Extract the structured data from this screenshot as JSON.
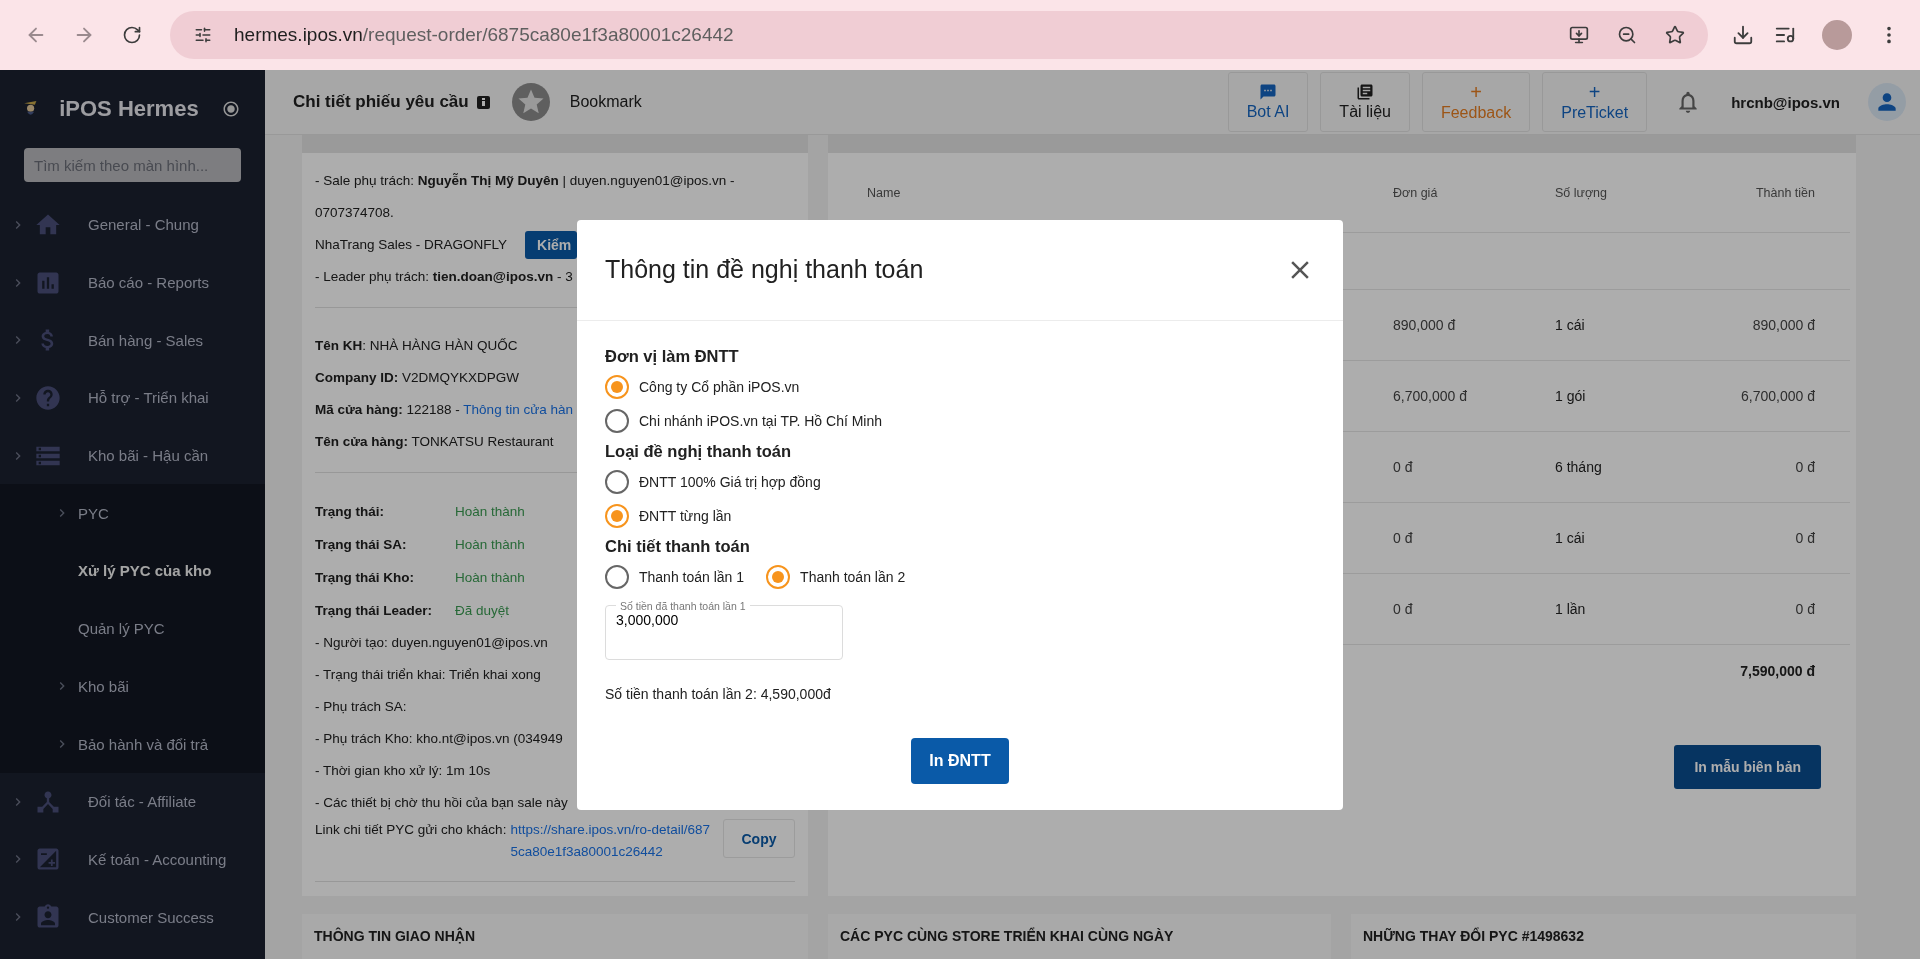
{
  "browser": {
    "url_host": "hermes.ipos.vn",
    "url_path": "/request-order/6875ca80e1f3a80001c26442"
  },
  "sidebar": {
    "brand": "iPOS Hermes",
    "search": {
      "placeholder": "Tìm kiếm theo màn hình..."
    },
    "items": [
      {
        "label": "General - Chung"
      },
      {
        "label": "Báo cáo - Reports"
      },
      {
        "label": "Bán hàng - Sales"
      },
      {
        "label": "Hỗ trợ - Triển khai"
      },
      {
        "label": "Kho bãi - Hậu cần",
        "expanded": true,
        "children": [
          {
            "label": "PYC",
            "kind": "group",
            "selected": false
          },
          {
            "label": "Xử lý PYC của kho",
            "kind": "link",
            "selected": true
          },
          {
            "label": "Quản lý PYC",
            "kind": "link",
            "selected": false
          },
          {
            "label": "Kho bãi",
            "kind": "group",
            "selected": false
          },
          {
            "label": "Bảo hành và đổi trả",
            "kind": "group",
            "selected": false
          }
        ]
      },
      {
        "label": "Đối tác - Affiliate"
      },
      {
        "label": "Kế toán - Accounting"
      },
      {
        "label": "Customer Success"
      }
    ]
  },
  "header": {
    "title": "Chi tiết phiếu yêu cầu",
    "bookmark": "Bookmark",
    "actions": [
      {
        "label": "Bot AI",
        "kind": "icon"
      },
      {
        "label": "Tài liệu",
        "kind": "icon"
      },
      {
        "label": "Feedback",
        "kind": "glyph",
        "glyph": "+"
      },
      {
        "label": "PreTicket",
        "kind": "glyph",
        "glyph": "+"
      }
    ],
    "user": "hrcnb@ipos.vn"
  },
  "request_card": {
    "sale_line": "- Sale phụ trách: **Nguyễn Thị Mỹ Duyên** | duyen.nguyen01@ipos.vn - 0707374708.",
    "team": "NhaTrang Sales - DRAGONFLY",
    "check_button": "Kiểm",
    "leader_line": "- Leader phụ trách: **tien.doan@ipos.vn** - 3",
    "customer": [
      {
        "text": "**Tên KH**: NHÀ HÀNG HÀN QUỐC"
      },
      {
        "text": "**Company ID:** V2DMQYKXDPGW"
      },
      {
        "text": "**Mã cửa hàng:** 122188 - ",
        "link": "Thông tin cửa hàn"
      },
      {
        "text": "**Tên cửa hàng:** TONKATSU Restaurant"
      }
    ],
    "statuses": [
      {
        "label": "Trạng thái:",
        "value": "Hoàn thành"
      },
      {
        "label": "Trạng thái SA:",
        "value": "Hoàn thành"
      },
      {
        "label": "Trạng thái Kho:",
        "value": "Hoàn thành"
      },
      {
        "label": "Trạng thái Leader:",
        "value": "Đã duyệt"
      }
    ],
    "notes": [
      "- Người tạo: duyen.nguyen01@ipos.vn",
      "- Trạng thái triển khai: Triển khai xong",
      "- Phụ trách SA:",
      "- Phụ trách Kho: kho.nt@ipos.vn (034949",
      "- Thời gian kho xử lý: 1m 10s",
      "- Các thiết bị chờ thu hồi của bạn sale này"
    ],
    "share": {
      "label": "Link chi tiết PYC gửi cho khách:",
      "link": "https://share.ipos.vn/ro-detail/6875ca80e1f3a80001c26442",
      "button": "Copy"
    }
  },
  "items_card": {
    "columns": [
      "Name",
      "Đơn giá",
      "Số lượng",
      "Thành tiền"
    ],
    "rows": [
      {
        "price": "890,000 đ",
        "qty": "1 cái",
        "total": "890,000 đ"
      },
      {
        "price": "6,700,000 đ",
        "qty": "1 gói",
        "total": "6,700,000 đ"
      },
      {
        "price": "0 đ",
        "qty": "6 tháng",
        "total": "0 đ"
      },
      {
        "price": "0 đ",
        "qty": "1 cái",
        "total": "0 đ"
      },
      {
        "price": "0 đ",
        "qty": "1 lần",
        "total": "0 đ"
      }
    ],
    "grand_total": "7,590,000 đ",
    "button": "In mẫu biên bản"
  },
  "bottom_cards": [
    "THÔNG TIN GIAO NHẬN",
    "CÁC PYC CÙNG STORE TRIỂN KHAI CÙNG NGÀY",
    "NHỮNG THAY ĐỔI PYC #1498632"
  ],
  "dialog": {
    "title": "Thông tin đề nghị thanh toán",
    "sections": [
      {
        "title": "Đơn vị làm ĐNTT",
        "kind": "list",
        "options": [
          {
            "label": "Công ty Cổ phần iPOS.vn",
            "selected": true
          },
          {
            "label": "Chi nhánh iPOS.vn tại TP. Hồ Chí Minh",
            "selected": false
          }
        ]
      },
      {
        "title": "Loại đề nghị thanh toán",
        "kind": "list",
        "options": [
          {
            "label": "ĐNTT 100% Giá trị hợp đồng",
            "selected": false
          },
          {
            "label": "ĐNTT từng lần",
            "selected": true
          }
        ]
      },
      {
        "title": "Chi tiết thanh toán",
        "kind": "inline",
        "options": [
          {
            "label": "Thanh toán lần 1",
            "selected": false
          },
          {
            "label": "Thanh toán lần 2",
            "selected": true
          }
        ]
      }
    ],
    "field": {
      "label": "Số tiền đã thanh toán lần 1",
      "value": "3,000,000"
    },
    "summary": "Số tiền thanh toán lần 2: 4,590,000đ",
    "button": "In ĐNTT"
  }
}
